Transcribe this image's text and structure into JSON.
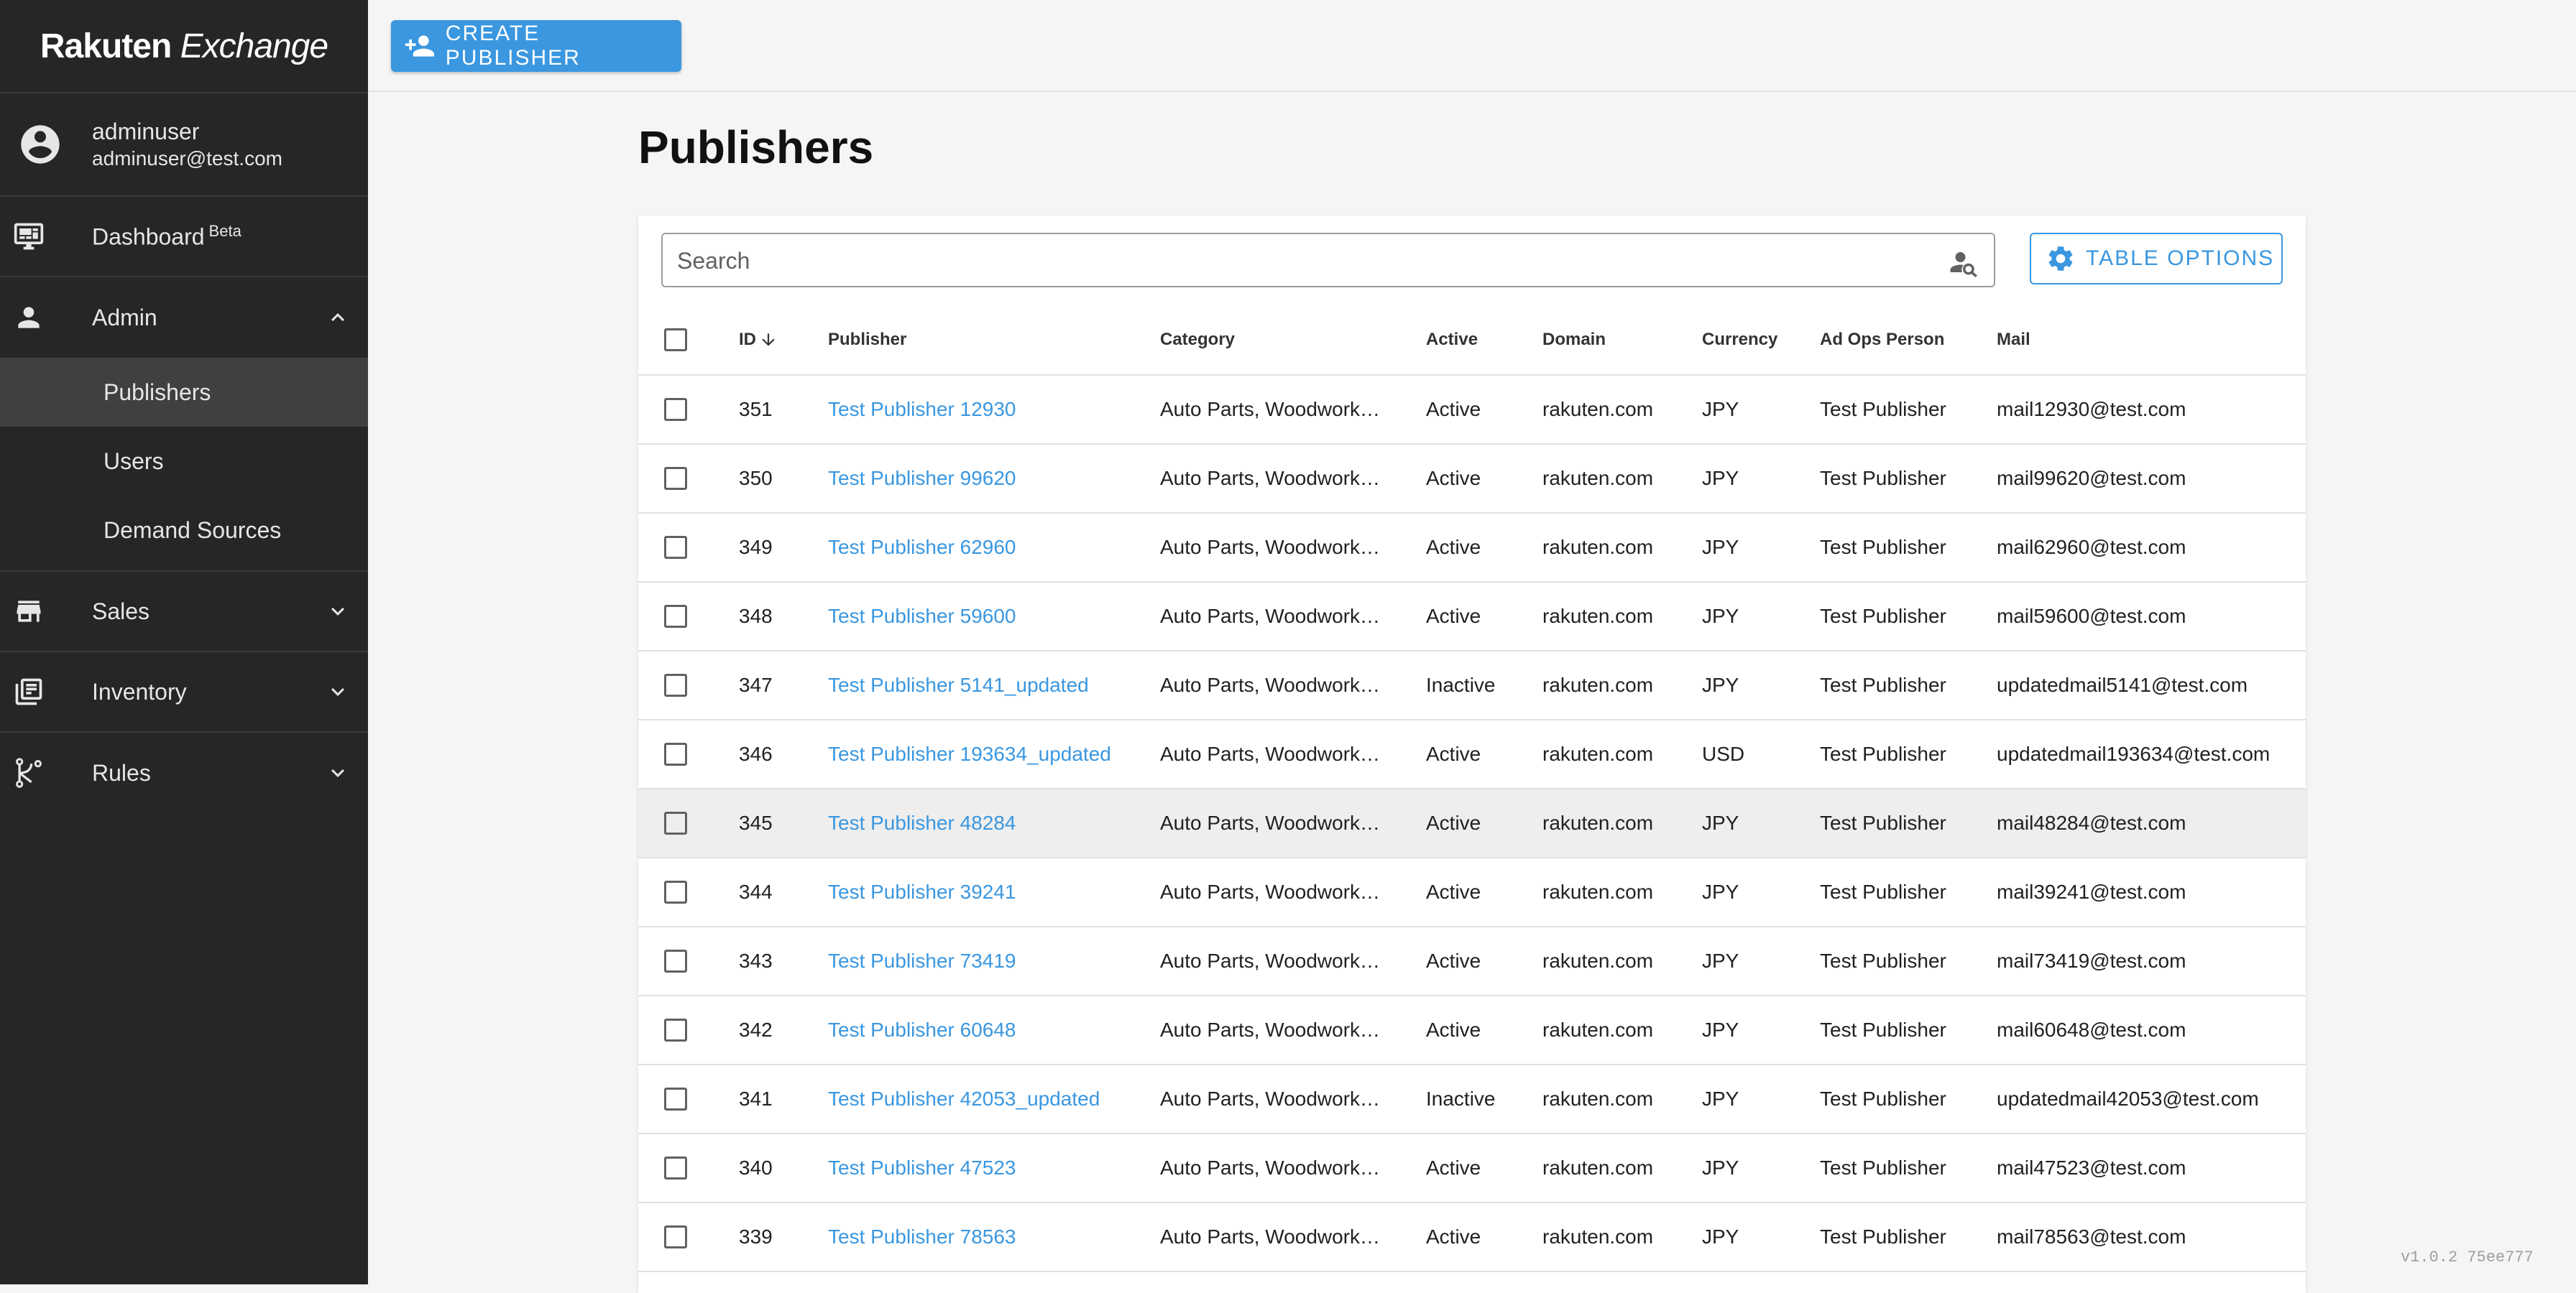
{
  "app": {
    "logo_brand": "Rakuten",
    "logo_product": "Exchange",
    "version": "v1.0.2 75ee777"
  },
  "user": {
    "name": "adminuser",
    "email": "adminuser@test.com"
  },
  "nav": {
    "dashboard": {
      "label": "Dashboard",
      "badge": "Beta",
      "icon": "monitor-dashboard-icon"
    },
    "admin": {
      "label": "Admin",
      "icon": "person-icon",
      "expanded": true,
      "items": [
        {
          "label": "Publishers",
          "selected": true
        },
        {
          "label": "Users"
        },
        {
          "label": "Demand Sources"
        }
      ]
    },
    "sales": {
      "label": "Sales",
      "icon": "store-icon"
    },
    "inventory": {
      "label": "Inventory",
      "icon": "newspaper-icon"
    },
    "rules": {
      "label": "Rules",
      "icon": "source-branch-icon"
    }
  },
  "toolbar": {
    "create_label": "CREATE PUBLISHER"
  },
  "page": {
    "title": "Publishers"
  },
  "search": {
    "placeholder": "Search"
  },
  "table_options_label": "TABLE OPTIONS",
  "table": {
    "headers": {
      "id": "ID",
      "publisher": "Publisher",
      "category": "Category",
      "active": "Active",
      "domain": "Domain",
      "currency": "Currency",
      "adops": "Ad Ops Person",
      "mail": "Mail"
    },
    "rows": [
      {
        "id": "351",
        "publisher": "Test Publisher 12930",
        "category": "Auto Parts, Woodwork…",
        "active": "Active",
        "domain": "rakuten.com",
        "currency": "JPY",
        "adops": "Test Publisher",
        "mail": "mail12930@test.com"
      },
      {
        "id": "350",
        "publisher": "Test Publisher 99620",
        "category": "Auto Parts, Woodwork…",
        "active": "Active",
        "domain": "rakuten.com",
        "currency": "JPY",
        "adops": "Test Publisher",
        "mail": "mail99620@test.com"
      },
      {
        "id": "349",
        "publisher": "Test Publisher 62960",
        "category": "Auto Parts, Woodwork…",
        "active": "Active",
        "domain": "rakuten.com",
        "currency": "JPY",
        "adops": "Test Publisher",
        "mail": "mail62960@test.com"
      },
      {
        "id": "348",
        "publisher": "Test Publisher 59600",
        "category": "Auto Parts, Woodwork…",
        "active": "Active",
        "domain": "rakuten.com",
        "currency": "JPY",
        "adops": "Test Publisher",
        "mail": "mail59600@test.com"
      },
      {
        "id": "347",
        "publisher": "Test Publisher 5141_updated",
        "category": "Auto Parts, Woodwork…",
        "active": "Inactive",
        "domain": "rakuten.com",
        "currency": "JPY",
        "adops": "Test Publisher",
        "mail": "updatedmail5141@test.com"
      },
      {
        "id": "346",
        "publisher": "Test Publisher 193634_updated",
        "category": "Auto Parts, Woodwork…",
        "active": "Active",
        "domain": "rakuten.com",
        "currency": "USD",
        "adops": "Test Publisher",
        "mail": "updatedmail193634@test.com"
      },
      {
        "id": "345",
        "publisher": "Test Publisher 48284",
        "category": "Auto Parts, Woodwork…",
        "active": "Active",
        "domain": "rakuten.com",
        "currency": "JPY",
        "adops": "Test Publisher",
        "mail": "mail48284@test.com",
        "hover": true
      },
      {
        "id": "344",
        "publisher": "Test Publisher 39241",
        "category": "Auto Parts, Woodwork…",
        "active": "Active",
        "domain": "rakuten.com",
        "currency": "JPY",
        "adops": "Test Publisher",
        "mail": "mail39241@test.com"
      },
      {
        "id": "343",
        "publisher": "Test Publisher 73419",
        "category": "Auto Parts, Woodwork…",
        "active": "Active",
        "domain": "rakuten.com",
        "currency": "JPY",
        "adops": "Test Publisher",
        "mail": "mail73419@test.com"
      },
      {
        "id": "342",
        "publisher": "Test Publisher 60648",
        "category": "Auto Parts, Woodwork…",
        "active": "Active",
        "domain": "rakuten.com",
        "currency": "JPY",
        "adops": "Test Publisher",
        "mail": "mail60648@test.com"
      },
      {
        "id": "341",
        "publisher": "Test Publisher 42053_updated",
        "category": "Auto Parts, Woodwork…",
        "active": "Inactive",
        "domain": "rakuten.com",
        "currency": "JPY",
        "adops": "Test Publisher",
        "mail": "updatedmail42053@test.com"
      },
      {
        "id": "340",
        "publisher": "Test Publisher 47523",
        "category": "Auto Parts, Woodwork…",
        "active": "Active",
        "domain": "rakuten.com",
        "currency": "JPY",
        "adops": "Test Publisher",
        "mail": "mail47523@test.com"
      },
      {
        "id": "339",
        "publisher": "Test Publisher 78563",
        "category": "Auto Parts, Woodwork…",
        "active": "Active",
        "domain": "rakuten.com",
        "currency": "JPY",
        "adops": "Test Publisher",
        "mail": "mail78563@test.com"
      }
    ]
  }
}
